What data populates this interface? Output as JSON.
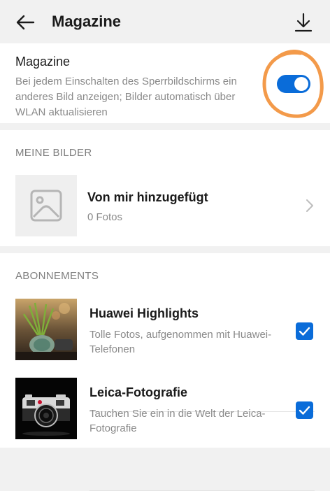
{
  "appbar": {
    "title": "Magazine",
    "back_icon": "arrow-left-icon",
    "download_icon": "download-icon"
  },
  "toggle_section": {
    "title": "Magazine",
    "description": "Bei jedem Einschalten des Sperrbildschirms ein anderes Bild anzeigen; Bilder automatisch über WLAN aktualisieren",
    "enabled": true,
    "accent_color": "#0a6cd9",
    "annotation_color": "#f39a4a"
  },
  "my_images": {
    "section_title": "MEINE BILDER",
    "item_title": "Von mir hinzugefügt",
    "item_subtitle": "0 Fotos",
    "thumb_icon": "image-placeholder-icon",
    "chevron_icon": "chevron-right-icon"
  },
  "subscriptions": {
    "section_title": "ABONNEMENTS",
    "items": [
      {
        "title": "Huawei Highlights",
        "description": "Tolle Fotos, aufgenommen mit Huawei-Telefonen",
        "checked": true
      },
      {
        "title": "Leica-Fotografie",
        "description": "Tauchen Sie ein in die Welt der Leica-Fotografie",
        "checked": true
      }
    ]
  }
}
